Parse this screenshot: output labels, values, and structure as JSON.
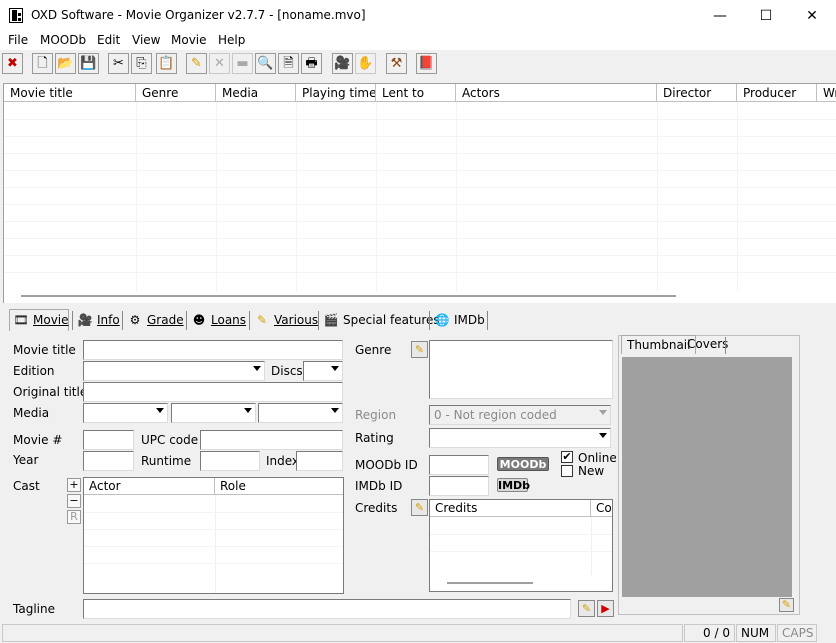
{
  "window": {
    "title": "OXD Software - Movie Organizer v2.7.7 - [noname.mvo]",
    "controls": {
      "minimize": "—",
      "maximize": "☐",
      "close": "✕"
    }
  },
  "menu": [
    "File",
    "MOODb",
    "Edit",
    "View",
    "Movie",
    "Help"
  ],
  "toolbar": {
    "icons": [
      "exit-icon",
      "new-icon",
      "open-icon",
      "save-icon",
      "cut-icon",
      "copy-icon",
      "paste-icon",
      "edit-icon",
      "delete-icon",
      "minus-icon",
      "find-icon",
      "preview-icon",
      "print-icon",
      "filmcamera-icon",
      "hand-icon",
      "tools-icon",
      "book-icon"
    ],
    "glyphs": {
      "exit": "✖",
      "new": "🗋",
      "open": "📂",
      "save": "💾",
      "cut": "✂",
      "copy": "⎘",
      "paste": "📋",
      "edit": "✎",
      "delete": "✕",
      "minus": "▬",
      "find": "🔍",
      "preview": "🗎",
      "print": "🖶",
      "camera": "🎥",
      "hand": "✋",
      "tools": "⚒",
      "book": "📕"
    }
  },
  "list": {
    "columns": [
      "Movie title",
      "Genre",
      "Media",
      "Playing time",
      "Lent to",
      "Actors",
      "Director",
      "Producer",
      "Wr"
    ]
  },
  "tabs": [
    {
      "label": "Movie",
      "icon": "movie-icon",
      "glyph": "🎞"
    },
    {
      "label": "Info",
      "icon": "info-icon",
      "glyph": "🎥"
    },
    {
      "label": "Grade",
      "icon": "grade-icon",
      "glyph": "⚙"
    },
    {
      "label": "Loans",
      "icon": "loans-icon",
      "glyph": "☻"
    },
    {
      "label": "Various",
      "icon": "various-icon",
      "glyph": "✎"
    },
    {
      "label": "Special features",
      "icon": "special-features-icon",
      "glyph": "🎬"
    },
    {
      "label": "IMDb",
      "icon": "imdb-globe-icon",
      "glyph": "🌐"
    }
  ],
  "form": {
    "movie_title": "Movie title",
    "edition": "Edition",
    "discs": "Discs",
    "original_title": "Original title",
    "media": "Media",
    "movie_no": "Movie #",
    "upc_code": "UPC code",
    "year": "Year",
    "runtime": "Runtime",
    "index": "Index",
    "cast": "Cast",
    "cast_buttons": {
      "add": "+",
      "remove": "−",
      "role": "R"
    },
    "cast_columns": [
      "Actor",
      "Role"
    ],
    "tagline": "Tagline",
    "genre": "Genre",
    "region": "Region",
    "region_value": "0 - Not region coded",
    "rating": "Rating",
    "moodb_id": "MOODb ID",
    "imdb_id": "IMDb ID",
    "moodb_badge": "MOODb",
    "imdb_badge": "IMDb",
    "online": "Online",
    "online_checked": "✔",
    "new": "New",
    "credits": "Credits",
    "credits_columns": [
      "Credits",
      "Cor"
    ]
  },
  "thumbnail": {
    "tabs": [
      "Thumbnail",
      "Covers"
    ]
  },
  "status": {
    "count": "0 / 0",
    "num": "NUM",
    "caps": "CAPS"
  }
}
